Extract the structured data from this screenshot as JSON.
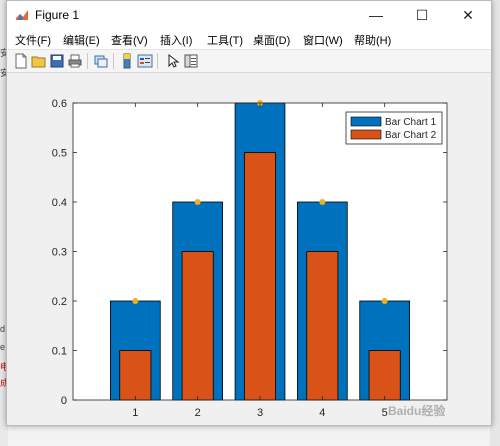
{
  "window": {
    "title": "Figure 1",
    "controls": {
      "minimize": "—",
      "maximize": "☐",
      "close": "✕"
    }
  },
  "menu": {
    "items": [
      "文件(F)",
      "编辑(E)",
      "查看(V)",
      "插入(I)",
      "工具(T)",
      "桌面(D)",
      "窗口(W)",
      "帮助(H)"
    ]
  },
  "toolbar": {
    "icons": [
      "new-figure-icon",
      "open-file-icon",
      "save-icon",
      "print-icon",
      "link-plot-icon",
      "insert-colorbar-icon",
      "insert-legend-icon",
      "edit-plot-icon",
      "property-inspector-icon"
    ]
  },
  "background_fragments": [
    "安",
    "安",
    "d",
    "e",
    "电",
    "成"
  ],
  "chart_data": {
    "type": "bar",
    "categories": [
      "1",
      "2",
      "3",
      "4",
      "5"
    ],
    "series": [
      {
        "name": "Bar Chart 1",
        "values": [
          0.2,
          0.4,
          0.6,
          0.4,
          0.2
        ],
        "color": "#0072BD"
      },
      {
        "name": "Bar Chart 2",
        "values": [
          0.1,
          0.3,
          0.5,
          0.3,
          0.1
        ],
        "color": "#D95319"
      }
    ],
    "markers": {
      "values": [
        0.2,
        0.4,
        0.6,
        0.4,
        0.2
      ],
      "color": "#EDB120"
    },
    "ylim": [
      0,
      0.6
    ],
    "yticks": [
      "0",
      "0.1",
      "0.2",
      "0.3",
      "0.4",
      "0.5",
      "0.6"
    ],
    "xlim": [
      0,
      6
    ],
    "legend_position": "top-right",
    "grid": false
  },
  "watermark": "Baidu经验"
}
